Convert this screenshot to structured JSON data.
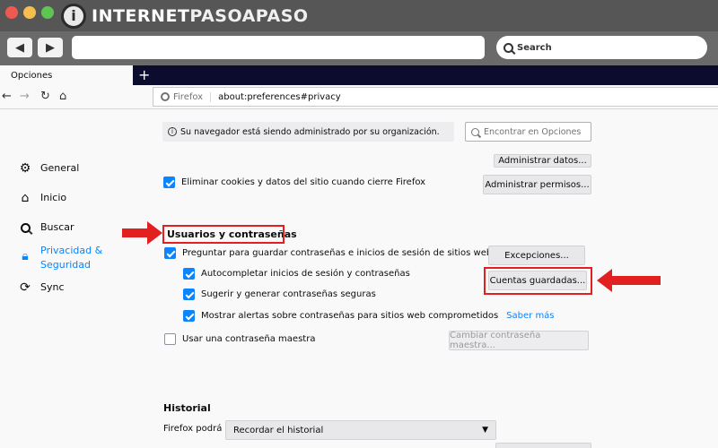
{
  "brand": {
    "logo_prefix": "INTERNET",
    "logo_accent": "PASOAPASO"
  },
  "outer_toolbar": {
    "search_label": "Search"
  },
  "tab": {
    "label": "Opciones"
  },
  "urlbar": {
    "identity": "Firefox",
    "url": "about:preferences#privacy"
  },
  "sidebar": {
    "items": [
      {
        "label": "General",
        "icon": "gear-icon"
      },
      {
        "label": "Inicio",
        "icon": "home-icon"
      },
      {
        "label": "Buscar",
        "icon": "search-icon"
      },
      {
        "label": "Privacidad & Seguridad",
        "icon": "lock-icon",
        "active": true
      },
      {
        "label": "Sync",
        "icon": "sync-icon"
      }
    ]
  },
  "notice": {
    "text": "Su navegador está siendo administrado por su organización."
  },
  "find": {
    "placeholder": "Encontrar en Opciones"
  },
  "cookies": {
    "manage_data_label": "Administrar datos...",
    "delete_label": "Eliminar cookies y datos del sitio cuando cierre Firefox",
    "manage_perms_label": "Administrar permisos..."
  },
  "logins": {
    "title": "Usuarios y contraseñas",
    "ask_save": "Preguntar para guardar contraseñas e inicios de sesión de sitios web",
    "exceptions_label": "Excepciones...",
    "autofill": "Autocompletar inicios de sesión y contraseñas",
    "saved_logins_label": "Cuentas guardadas...",
    "suggest": "Sugerir y generar contraseñas seguras",
    "breach_alerts": "Mostrar alertas sobre contraseñas para sitios web comprometidos",
    "learn_more": "Saber más",
    "master_password": "Usar una contraseña maestra",
    "change_master_label": "Cambiar contraseña maestra..."
  },
  "history": {
    "title": "Historial",
    "prefix": "Firefox podrá",
    "mode": "Recordar el historial"
  },
  "colors": {
    "accent": "#0a84ff",
    "highlight": "#e32020"
  }
}
